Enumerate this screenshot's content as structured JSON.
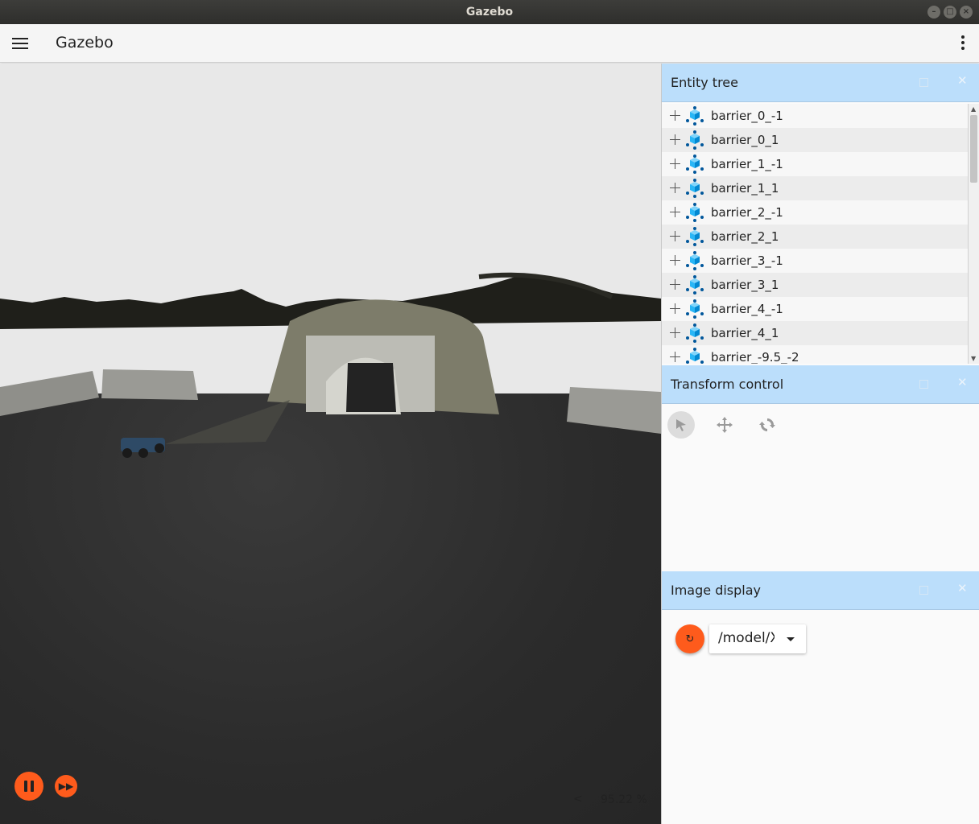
{
  "window": {
    "title": "Gazebo",
    "controls": [
      "minimize",
      "maximize",
      "close"
    ]
  },
  "appbar": {
    "title": "Gazebo",
    "menu_icon": "hamburger-icon",
    "more_icon": "kebab-icon"
  },
  "viewport": {
    "real_time_factor": "95.22 %",
    "collapse_glyph": "<",
    "controls": {
      "pause_icon": "pause-icon",
      "step_icon": "fast-forward-icon"
    }
  },
  "entity_tree": {
    "title": "Entity tree",
    "items": [
      {
        "label": "barrier_0_-1"
      },
      {
        "label": "barrier_0_1"
      },
      {
        "label": "barrier_1_-1"
      },
      {
        "label": "barrier_1_1"
      },
      {
        "label": "barrier_2_-1"
      },
      {
        "label": "barrier_2_1"
      },
      {
        "label": "barrier_3_-1"
      },
      {
        "label": "barrier_3_1"
      },
      {
        "label": "barrier_4_-1"
      },
      {
        "label": "barrier_4_1"
      },
      {
        "label": "barrier_-9.5_-2"
      }
    ]
  },
  "transform_control": {
    "title": "Transform control",
    "tools": [
      "select-icon",
      "translate-icon",
      "rotate-icon"
    ]
  },
  "image_display": {
    "title": "Image display",
    "refresh_glyph": "↻",
    "topic_value": "/model/X"
  },
  "colors": {
    "accent": "#fe5b1c",
    "panel_header": "#bbdefb",
    "model_icon": "#29b6f6"
  }
}
